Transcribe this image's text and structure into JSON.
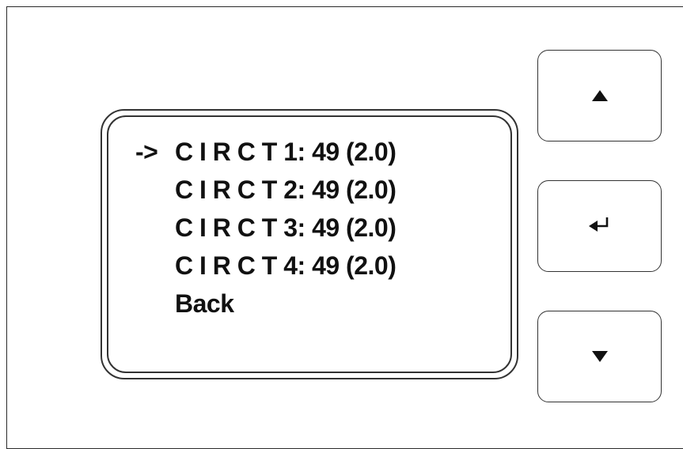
{
  "display": {
    "cursor": "->",
    "items": [
      {
        "label": "C I R C T 1: 49 (2.0)",
        "selected": true
      },
      {
        "label": "C I R C T 2: 49 (2.0)",
        "selected": false
      },
      {
        "label": "C I R C T 3: 49 (2.0)",
        "selected": false
      },
      {
        "label": "C I R C T 4: 49 (2.0)",
        "selected": false
      },
      {
        "label": "Back",
        "selected": false
      }
    ]
  },
  "buttons": {
    "up": {
      "icon": "triangle-up-icon"
    },
    "enter": {
      "icon": "enter-return-icon"
    },
    "down": {
      "icon": "triangle-down-icon"
    }
  },
  "colors": {
    "foreground": "#111111",
    "border": "#333333",
    "background": "#ffffff"
  }
}
